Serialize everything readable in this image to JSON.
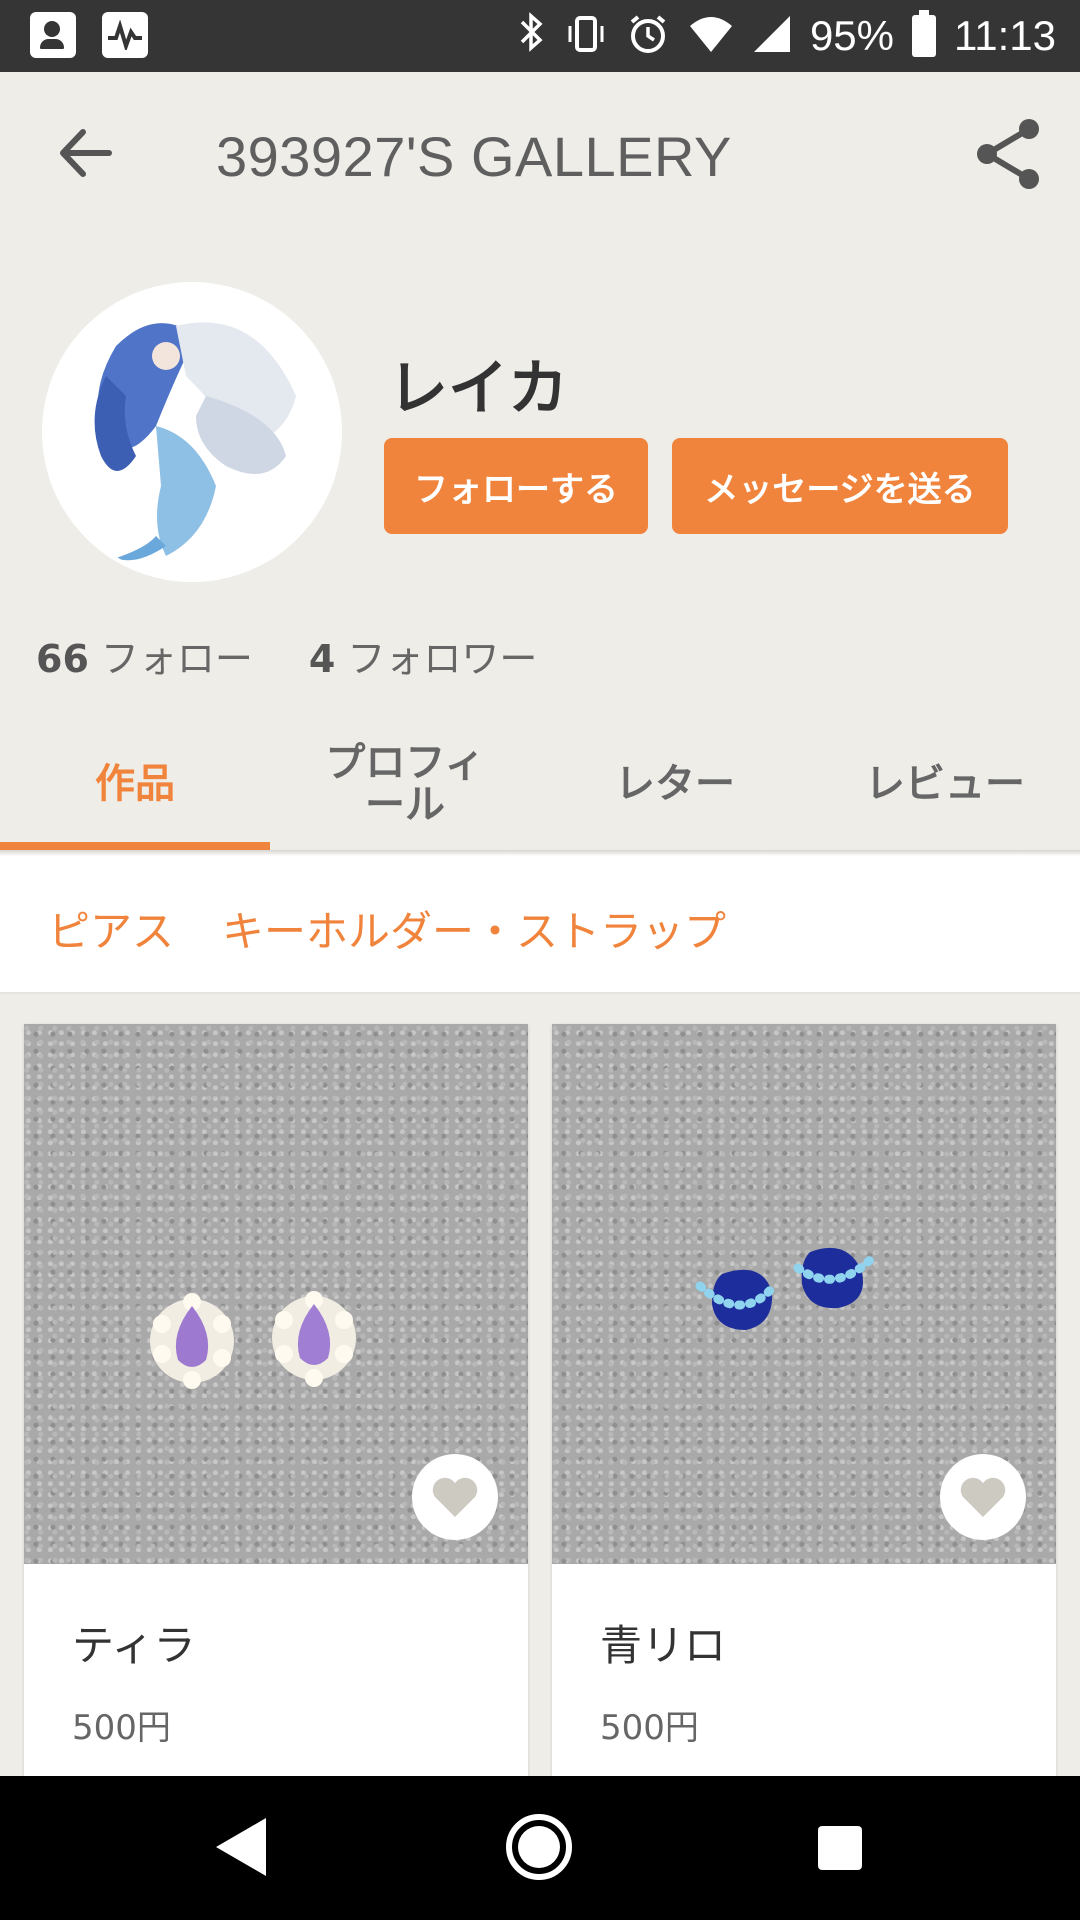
{
  "status_bar": {
    "battery": "95%",
    "time": "11:13"
  },
  "header": {
    "title": "393927'S GALLERY"
  },
  "profile": {
    "name": "レイカ",
    "follow_button": "フォローする",
    "message_button": "メッセージを送る",
    "following_count": "66",
    "following_label": "フォロー",
    "followers_count": "4",
    "followers_label": "フォロワー"
  },
  "tabs": [
    {
      "label": "作品"
    },
    {
      "label": "プロフィール"
    },
    {
      "label": "レター"
    },
    {
      "label": "レビュー"
    }
  ],
  "categories": [
    {
      "label": "ピアス"
    },
    {
      "label": "キーホルダー・ストラップ"
    }
  ],
  "items": [
    {
      "name": "ティラ",
      "price": "500円"
    },
    {
      "name": "青リロ",
      "price": "500円"
    }
  ],
  "colors": {
    "accent": "#f0843c",
    "background": "#efede8",
    "status_bar": "#353535"
  }
}
